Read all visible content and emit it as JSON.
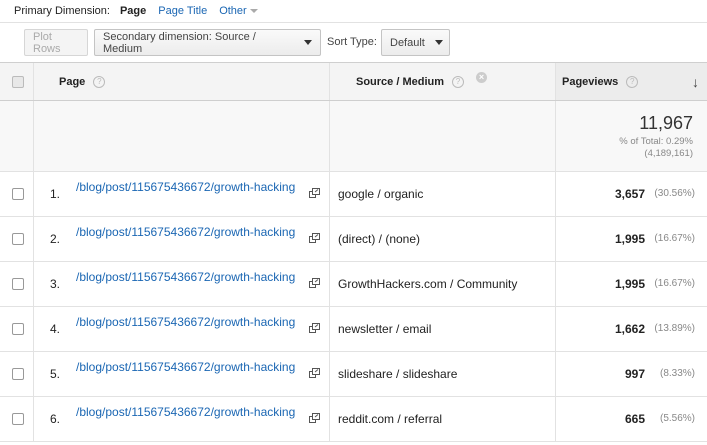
{
  "primary": {
    "label": "Primary Dimension:",
    "options": [
      {
        "label": "Page",
        "active": true
      },
      {
        "label": "Page Title",
        "active": false
      },
      {
        "label": "Other",
        "active": false
      }
    ]
  },
  "toolbar": {
    "plot_rows": "Plot Rows",
    "secondary_dimension": "Secondary dimension: Source / Medium",
    "sort_type_label": "Sort Type:",
    "sort_type_value": "Default"
  },
  "table": {
    "headers": {
      "page": "Page",
      "source_medium": "Source / Medium",
      "pageviews": "Pageviews"
    },
    "totals": {
      "value": "11,967",
      "pct_line": "% of Total: 0.29%",
      "overall": "(4,189,161)"
    },
    "rows": [
      {
        "index": "1.",
        "page": "/blog/post/115675436672/growth-hacking",
        "source": "google / organic",
        "pageviews": "3,657",
        "pct": "(30.56%)"
      },
      {
        "index": "2.",
        "page": "/blog/post/115675436672/growth-hacking",
        "source": "(direct) / (none)",
        "pageviews": "1,995",
        "pct": "(16.67%)"
      },
      {
        "index": "3.",
        "page": "/blog/post/115675436672/growth-hacking",
        "source": "GrowthHackers.com / Community",
        "pageviews": "1,995",
        "pct": "(16.67%)"
      },
      {
        "index": "4.",
        "page": "/blog/post/115675436672/growth-hacking",
        "source": "newsletter / email",
        "pageviews": "1,662",
        "pct": "(13.89%)"
      },
      {
        "index": "5.",
        "page": "/blog/post/115675436672/growth-hacking",
        "source": "slideshare / slideshare",
        "pageviews": "997",
        "pct": "(8.33%)"
      },
      {
        "index": "6.",
        "page": "/blog/post/115675436672/growth-hacking",
        "source": "reddit.com / referral",
        "pageviews": "665",
        "pct": "(5.56%)"
      }
    ]
  }
}
